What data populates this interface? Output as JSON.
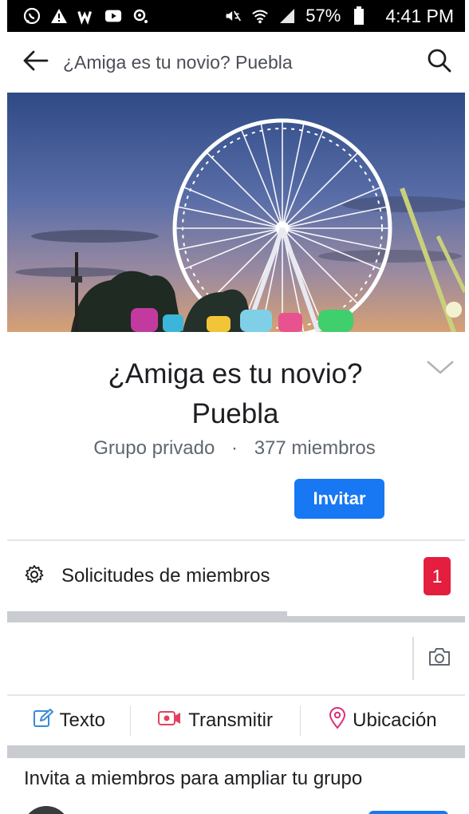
{
  "status_bar": {
    "icons_left": [
      "whatsapp-icon",
      "warning-icon",
      "wattpad-icon",
      "youtube-icon",
      "camera-notification-icon"
    ],
    "icons_right": [
      "mute-icon",
      "wifi-icon",
      "signal-icon",
      "battery-icon"
    ],
    "battery": "57%",
    "time": "4:41 PM"
  },
  "app_bar": {
    "title": "¿Amiga es tu novio? Puebla"
  },
  "group": {
    "title": "¿Amiga es tu novio? Puebla",
    "privacy": "Grupo privado",
    "separator": "·",
    "members": "377 miembros",
    "invite_label": "Invitar"
  },
  "requests": {
    "label": "Solicitudes de miembros",
    "count": "1"
  },
  "actions": [
    {
      "label": "Texto",
      "icon": "edit-icon"
    },
    {
      "label": "Transmitir",
      "icon": "live-video-icon"
    },
    {
      "label": "Ubicación",
      "icon": "location-pin-icon"
    }
  ],
  "invite_section": {
    "heading": "Invita a miembros para ampliar tu grupo"
  },
  "colors": {
    "accent": "#1877f2",
    "badge": "#e41e3f",
    "live": "#e4405f",
    "location": "#d9307a",
    "edit": "#3b8ad8"
  }
}
